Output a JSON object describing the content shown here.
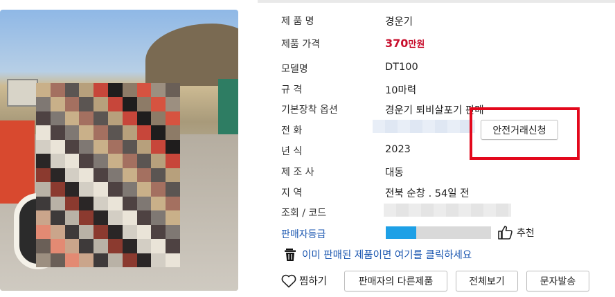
{
  "product": {
    "rows": [
      {
        "label": "제 품 명",
        "value": "경운기"
      },
      {
        "label": "제품 가격",
        "price_number": "370",
        "price_unit": "만원"
      },
      {
        "label": "모델명",
        "value": "DT100"
      },
      {
        "label": "규 격",
        "value": "10마력"
      },
      {
        "label": "기본장착 옵션",
        "value": "경운기 퇴비살포기 판매"
      },
      {
        "label": "전 화"
      },
      {
        "label": "년 식",
        "value": "2023"
      },
      {
        "label": "제 조 사",
        "value": "대동"
      },
      {
        "label": "지 역",
        "value": "전북 순창 . 54일 전"
      },
      {
        "label": "조회 / 코드"
      },
      {
        "label": "판매자등급"
      }
    ],
    "seller_grade_fraction": 0.29
  },
  "buttons": {
    "safe_trade": "안전거래신청",
    "recommend": "추천",
    "sold_notice": "이미 판매된 제품이면 여기를 클릭하세요",
    "wishlist": "찜하기",
    "other_products": "판매자의 다른제품",
    "view_all": "전체보기",
    "send_sms": "문자발송"
  },
  "icons": {
    "recommend": "thumbs-up-icon",
    "sold": "trash-icon",
    "wishlist": "heart-icon"
  },
  "colors": {
    "price": "#c8102e",
    "link": "#1a56b0",
    "grade_fill": "#1ea0e6",
    "highlight": "#e3081c"
  }
}
